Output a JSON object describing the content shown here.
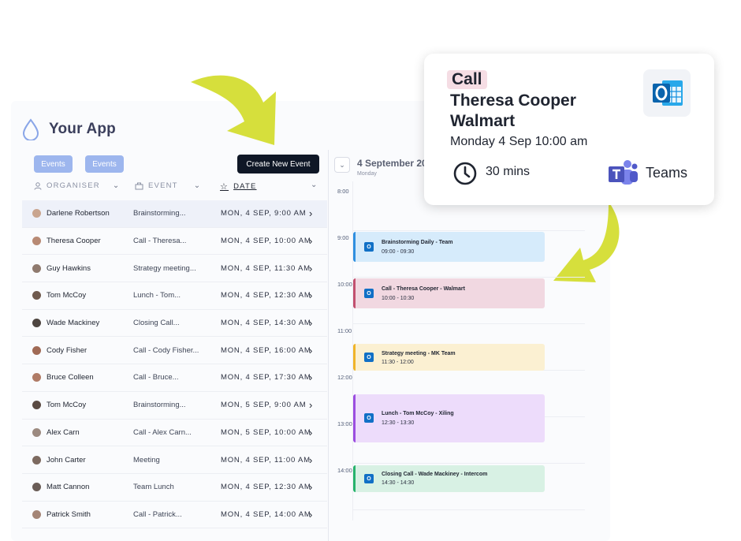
{
  "app": {
    "title": "Your App"
  },
  "toolbar": {
    "pill1": "Events",
    "pill2": "Events",
    "create_label": "Create New Event"
  },
  "columns": {
    "organiser": "ORGANISER",
    "event": "EVENT",
    "date": "DATE"
  },
  "rows": [
    {
      "organiser": "Darlene Robertson",
      "event": "Brainstorming...",
      "date": "MON, 4 SEP, 9:00 AM"
    },
    {
      "organiser": "Theresa Cooper",
      "event": "Call - Theresa...",
      "date": "MON, 4 SEP, 10:00 AM"
    },
    {
      "organiser": "Guy Hawkins",
      "event": "Strategy meeting...",
      "date": "MON, 4 SEP, 11:30 AM"
    },
    {
      "organiser": "Tom McCoy",
      "event": "Lunch - Tom...",
      "date": "MON, 4 SEP, 12:30 AM"
    },
    {
      "organiser": "Wade Mackiney",
      "event": "Closing Call...",
      "date": "MON, 4 SEP, 14:30 AM"
    },
    {
      "organiser": "Cody Fisher",
      "event": "Call - Cody Fisher...",
      "date": "MON, 4 SEP, 16:00 AM"
    },
    {
      "organiser": "Bruce Colleen",
      "event": "Call - Bruce...",
      "date": "MON, 4 SEP, 17:30 AM"
    },
    {
      "organiser": "Tom McCoy",
      "event": "Brainstorming...",
      "date": "MON, 5 SEP, 9:00 AM"
    },
    {
      "organiser": "Alex Carn",
      "event": "Call - Alex Carn...",
      "date": "MON, 5 SEP, 10:00 AM"
    },
    {
      "organiser": "John Carter",
      "event": "Meeting",
      "date": "MON, 4 SEP, 11:00 AM"
    },
    {
      "organiser": "Matt Cannon",
      "event": "Team Lunch",
      "date": "MON, 4 SEP, 12:30 AM"
    },
    {
      "organiser": "Patrick Smith",
      "event": "Call - Patrick...",
      "date": "MON, 4 SEP, 14:00 AM"
    }
  ],
  "calendar": {
    "date": "4 September 20",
    "day": "Monday",
    "hours": [
      "8:00",
      "9:00",
      "10:00",
      "11:00",
      "12:00",
      "13:00",
      "14:00"
    ],
    "events": [
      {
        "title": "Brainstorming Daily - Team",
        "time": "09:00 - 09:30",
        "bg": "#d6ebfb",
        "border": "#2f8fe0"
      },
      {
        "title": "Call - Theresa Cooper - Walmart",
        "time": "10:00 - 10:30",
        "bg": "#f1d8e1",
        "border": "#c2506f"
      },
      {
        "title": "Strategy meeting - MK Team",
        "time": "11:30 - 12:00",
        "bg": "#fbf0d2",
        "border": "#f0b429"
      },
      {
        "title": "Lunch - Tom McCoy - Xiling",
        "time": "12:30 - 13:30",
        "bg": "#eddcfb",
        "border": "#9b4de0"
      },
      {
        "title": "Closing Call - Wade Mackiney - Intercom",
        "time": "14:30 - 14:30",
        "bg": "#d8f1e4",
        "border": "#27b36c"
      }
    ]
  },
  "popup": {
    "tag": "Call",
    "name": "Theresa Cooper",
    "company": "Walmart",
    "when": "Monday 4 Sep 10:00 am",
    "duration": "30 mins",
    "platform": "Teams"
  },
  "colors": {
    "accent": "#0f1726",
    "pill": "#9db6ee",
    "arrow": "#d6df3c"
  },
  "icons": [
    "droplet-icon",
    "user-icon",
    "briefcase-icon",
    "star-icon",
    "chevron-down-icon",
    "chevron-right-icon",
    "outlook-icon",
    "clock-icon",
    "teams-icon"
  ]
}
